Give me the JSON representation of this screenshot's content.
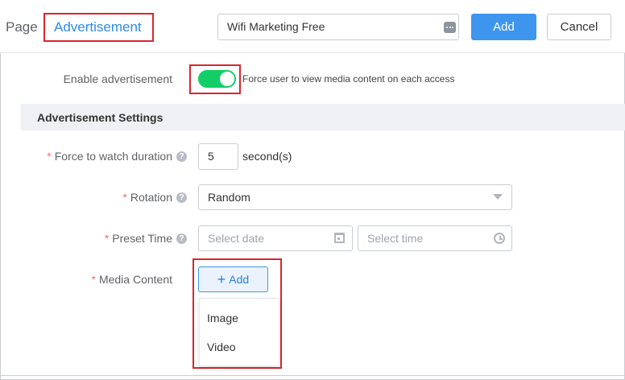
{
  "header": {
    "page_label": "Page",
    "active_tab": "Advertisement",
    "name_value": "Wifi Marketing Free",
    "add_label": "Add",
    "cancel_label": "Cancel"
  },
  "enable": {
    "label": "Enable advertisement",
    "enabled": true,
    "description": "Force user to view media content on each access"
  },
  "section": {
    "title": "Advertisement Settings"
  },
  "duration": {
    "label": "Force to watch duration",
    "value": "5",
    "unit": "second(s)"
  },
  "rotation": {
    "label": "Rotation",
    "value": "Random"
  },
  "preset_time": {
    "label": "Preset Time",
    "date_placeholder": "Select date",
    "time_placeholder": "Select time"
  },
  "media": {
    "label": "Media Content",
    "add_label": "Add",
    "options": [
      "Image",
      "Video"
    ]
  },
  "colors": {
    "primary": "#3d95ee",
    "toggle_on": "#13ce66",
    "highlight": "#d9262f",
    "required": "#f56c6c"
  },
  "icons": [
    "more-dots-icon",
    "help-icon",
    "caret-down-icon",
    "calendar-icon",
    "clock-icon",
    "plus-icon"
  ]
}
